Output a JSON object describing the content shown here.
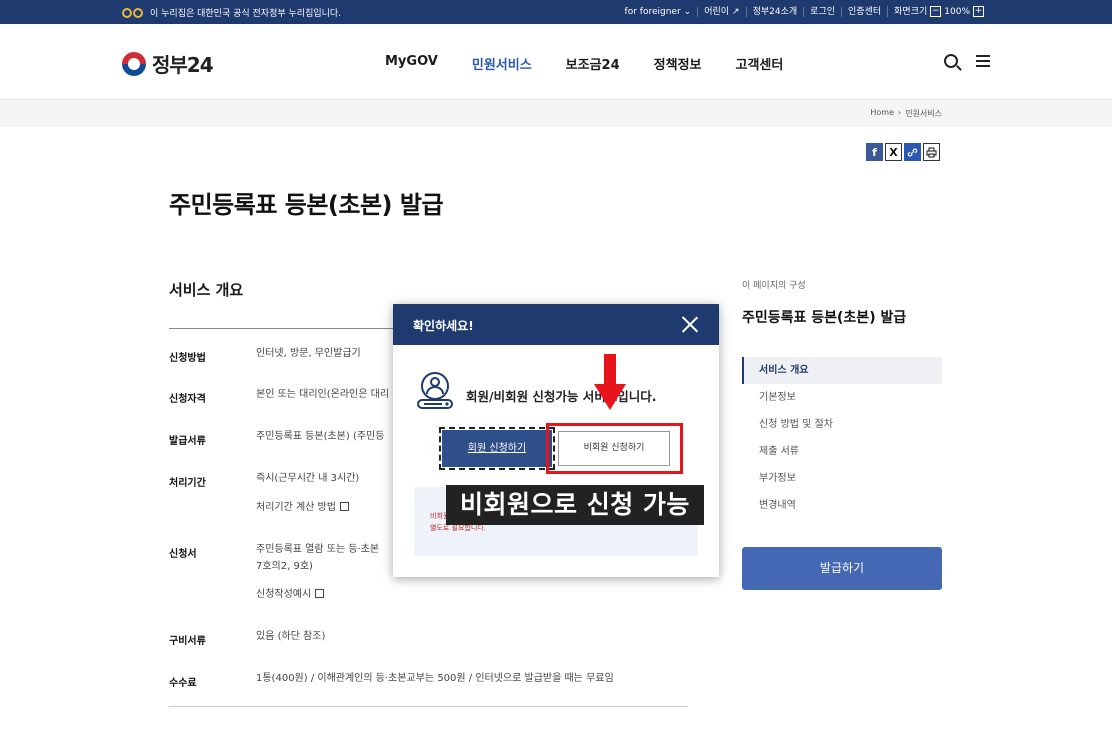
{
  "topbar": {
    "gov_notice": "이 누리집은 대한민국 공식 전자정부 누리집입니다.",
    "util": [
      "for foreigner",
      "어린이",
      "정부24소개",
      "로그인",
      "인증센터"
    ],
    "zoom_label": "화면크기",
    "zoom_value": "100%",
    "zoom_minus": "−",
    "zoom_plus": "+"
  },
  "header": {
    "logo_text": "정부24",
    "nav": [
      "MyGOV",
      "민원서비스",
      "보조금24",
      "정책정보",
      "고객센터"
    ]
  },
  "breadcrumb": [
    "Home",
    "민원서비스"
  ],
  "share": {
    "facebook": "f",
    "x": "X",
    "link": "🔗",
    "print": "⎙"
  },
  "page_title": "주민등록표 등본(초본) 발급",
  "section_title": "서비스 개요",
  "rows": [
    {
      "label": "신청방법",
      "value": "인터넷, 방문, 무인발급기"
    },
    {
      "label": "신청자격",
      "value": "본인 또는 대리인(온라인은 대리"
    },
    {
      "label": "발급서류",
      "value": "주민등록표 등본(초본) (주민등"
    },
    {
      "label": "처리기간",
      "value": "즉시(근무시간 내 3시간)",
      "extra": "처리기간 계산 방법"
    },
    {
      "label": "신청서",
      "value": "주민등록표 열람 또는 등·초본",
      "value2": "7호의2, 9호)",
      "extra": "신청작성예시"
    },
    {
      "label": "구비서류",
      "value": "있음 (하단 참조)"
    },
    {
      "label": "수수료",
      "value": "1통(400원) / 이해관계인의 등·초본교부는 500원 / 인터넷으로 발급받을 때는 무료임"
    }
  ],
  "side": {
    "small": "이 페이지의 구성",
    "title": "주민등록표 등본(초본) 발급",
    "nav": [
      "서비스 개요",
      "기본정보",
      "신청 방법 및 절차",
      "제출 서류",
      "부가정보",
      "변경내역"
    ],
    "issue_button": "발급하기"
  },
  "modal": {
    "title": "확인하세요!",
    "message": "회원/비회원 신청가능 서비스입니다.",
    "member_button": "회원 신청하기",
    "nonmember_button": "비회원 신청하기",
    "notice_line1": "비회원",
    "notice_line2": "별도로 필요합니다."
  },
  "caption": "비회원으로 신청 가능",
  "colors": {
    "navy": "#1e3a6e",
    "accent": "#2a58b3",
    "red": "#e8141b",
    "button": "#4468b4"
  }
}
